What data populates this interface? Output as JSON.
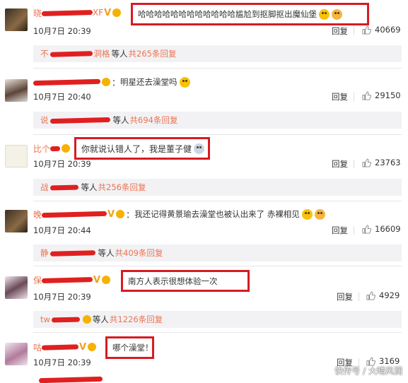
{
  "comments": [
    {
      "name_visible": "晓",
      "name_suffix": "XF",
      "time": "10月7日 20:39",
      "text": "哈哈哈哈哈哈哈哈哈哈哈哈尴尬到抠脚抠出魔仙堡",
      "reply": "回复",
      "likes": "40669",
      "sub_names": "不",
      "sub_names_suffix": "洞格",
      "sub_text": "等人",
      "sub_count": "共265条回复"
    },
    {
      "name_visible": "",
      "name_suffix": "",
      "time": "10月7日 20:40",
      "text": "明星还去澡堂吗",
      "reply": "回复",
      "likes": "29150",
      "sub_names": "说",
      "sub_names_suffix": "",
      "sub_text": "等人",
      "sub_count": "共694条回复"
    },
    {
      "name_visible": "比个",
      "name_suffix": "",
      "time": "10月7日 20:39",
      "text": "你就说认错人了，我是董子健",
      "reply": "回复",
      "likes": "23763",
      "sub_names": "战",
      "sub_names_suffix": "",
      "sub_text": "等人",
      "sub_count": "共256条回复"
    },
    {
      "name_visible": "晚",
      "name_suffix": "",
      "time": "10月7日 20:44",
      "text": "我还记得黄景瑜去澡堂也被认出来了 赤裸相见",
      "reply": "回复",
      "likes": "16609",
      "sub_names": "静",
      "sub_names_suffix": "",
      "sub_text": "等人",
      "sub_count": "共409条回复"
    },
    {
      "name_visible": "保",
      "name_suffix": "",
      "time": "10月7日 20:39",
      "text": "南方人表示很想体验一次",
      "reply": "回复",
      "likes": "4929",
      "sub_names": "tw",
      "sub_names_suffix": "",
      "sub_text": "等人",
      "sub_count": "共1226条回复"
    },
    {
      "name_visible": "咕",
      "name_suffix": "",
      "time": "10月7日 20:39",
      "text": "哪个澡堂！",
      "reply": "回复",
      "likes": "3169"
    }
  ],
  "watermark": "快传号 / 大晴风润",
  "colors": {
    "highlight": "#d71b21",
    "username": "#eb7350",
    "subbar_bg": "#f2f2f5"
  }
}
